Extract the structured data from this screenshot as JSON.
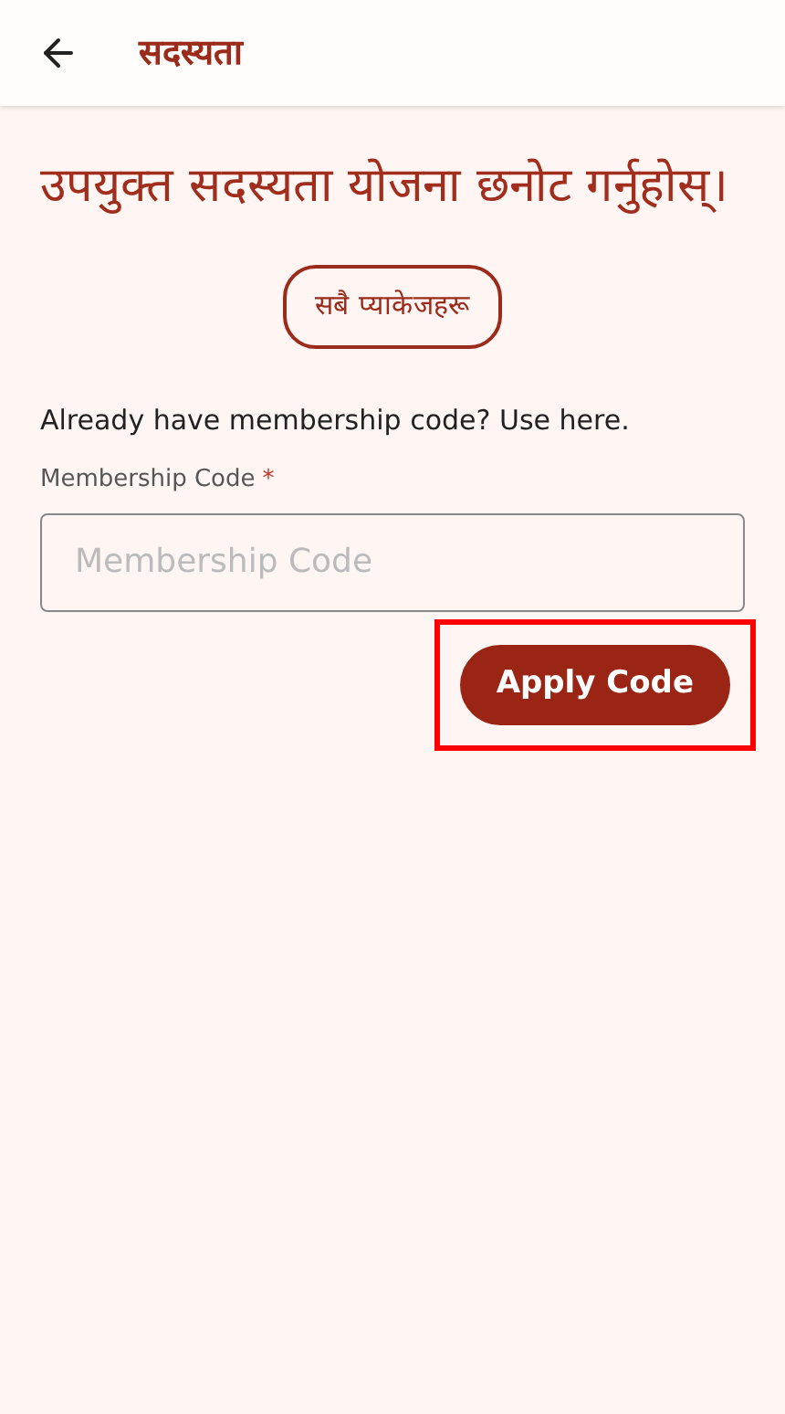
{
  "header": {
    "title": "सदस्यता"
  },
  "heading": "उपयुक्त सदस्यता योजना छनोट गर्नुहोस्।",
  "all_packages_button": "सबै प्याकेजहरू",
  "prompt": "Already have membership code? Use here.",
  "code_field": {
    "label": "Membership Code",
    "required_mark": "*",
    "placeholder": "Membership Code"
  },
  "apply_button": {
    "label": "Apply Code",
    "highlighted": true
  }
}
